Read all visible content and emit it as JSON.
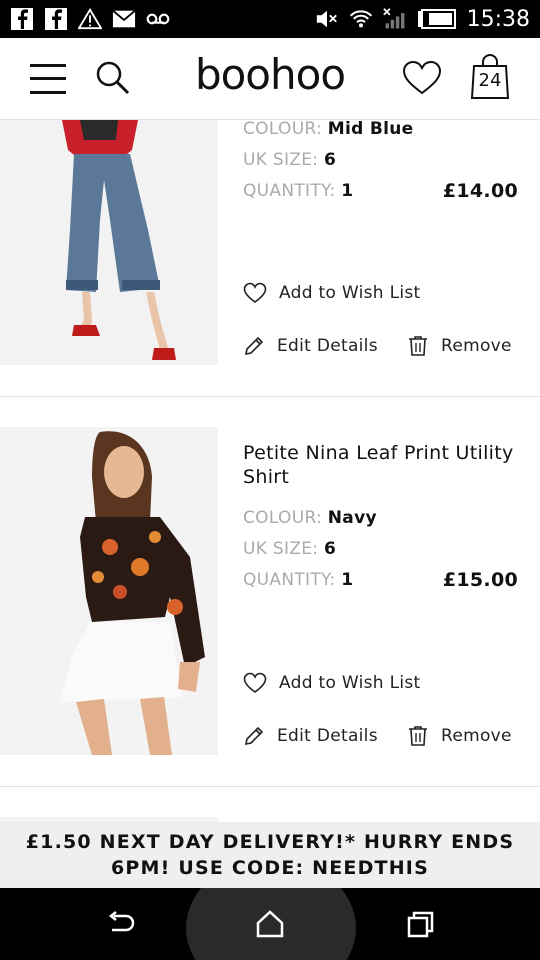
{
  "status_bar": {
    "time": "15:38",
    "icons": [
      "facebook-icon",
      "facebook-icon",
      "warning-icon",
      "mail-icon",
      "voicemail-icon",
      "mute-icon",
      "wifi-icon",
      "signal-icon",
      "battery-icon"
    ]
  },
  "header": {
    "brand": "boohoo",
    "bag_count": "24"
  },
  "items": [
    {
      "title": "",
      "colour_label": "COLOUR:",
      "colour": "Mid Blue",
      "size_label": "UK SIZE:",
      "size": "6",
      "quantity_label": "QUANTITY:",
      "quantity": "1",
      "price": "£14.00",
      "wishlist_label": "Add to Wish List",
      "edit_label": "Edit Details",
      "remove_label": "Remove"
    },
    {
      "title": "Petite Nina Leaf Print Utility Shirt",
      "colour_label": "COLOUR:",
      "colour": "Navy",
      "size_label": "UK SIZE:",
      "size": "6",
      "quantity_label": "QUANTITY:",
      "quantity": "1",
      "price": "£15.00",
      "wishlist_label": "Add to Wish List",
      "edit_label": "Edit Details",
      "remove_label": "Remove"
    }
  ],
  "promo": {
    "text": "£1.50 NEXT DAY DELIVERY!* HURRY ENDS 6PM! USE CODE: NEEDTHIS"
  },
  "nav_bar": {
    "buttons": [
      "back-icon",
      "home-icon",
      "recent-apps-icon"
    ]
  }
}
